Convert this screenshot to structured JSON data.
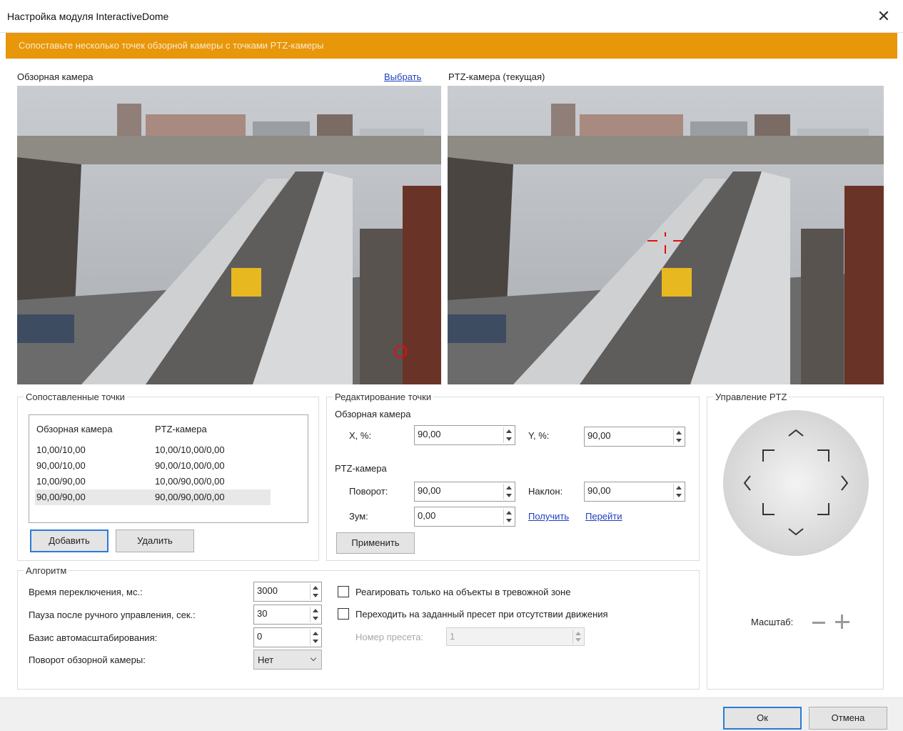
{
  "window": {
    "title": "Настройка модуля InteractiveDome",
    "close_glyph": "✕"
  },
  "banner": {
    "text": "Сопоставьте несколько точек обзорной камеры с точками PTZ-камеры"
  },
  "overview_camera": {
    "label": "Обзорная камера",
    "select_link": "Выбрать"
  },
  "ptz_camera": {
    "label": "PTZ-камера (текущая)"
  },
  "mapped_points": {
    "group_title": "Сопоставленные точки",
    "columns": [
      "Обзорная камера",
      "PTZ-камера"
    ],
    "rows": [
      [
        "10,00/10,00",
        "10,00/10,00/0,00"
      ],
      [
        "90,00/10,00",
        "90,00/10,00/0,00"
      ],
      [
        "10,00/90,00",
        "10,00/90,00/0,00"
      ],
      [
        "90,00/90,00",
        "90,00/90,00/0,00"
      ]
    ],
    "add_button": "Добавить",
    "delete_button": "Удалить"
  },
  "edit_point": {
    "group_title": "Редактирование точки",
    "overview_section": "Обзорная камера",
    "x_label": "X, %:",
    "x_value": "90,00",
    "y_label": "Y, %:",
    "y_value": "90,00",
    "ptz_section": "PTZ-камера",
    "pan_label": "Поворот:",
    "pan_value": "90,00",
    "tilt_label": "Наклон:",
    "tilt_value": "90,00",
    "zoom_label": "Зум:",
    "zoom_value": "0,00",
    "get_link": "Получить",
    "goto_link": "Перейти",
    "apply_button": "Применить"
  },
  "ptz_control": {
    "group_title": "Управление PTZ",
    "zoom_label": "Масштаб:"
  },
  "algorithm": {
    "group_title": "Алгоритм",
    "switch_time_label": "Время переключения, мс.:",
    "switch_time_value": "3000",
    "pause_label": "Пауза после ручного управления, сек.:",
    "pause_value": "30",
    "autoscale_label": "Базис автомасштабирования:",
    "autoscale_value": "0",
    "rotation_label": "Поворот обзорной камеры:",
    "rotation_value": "Нет",
    "alarm_zone_checkbox": "Реагировать только на объекты в тревожной зоне",
    "preset_checkbox": "Переходить на заданный пресет при отсутствии движения",
    "preset_number_label": "Номер пресета:",
    "preset_number_value": "1"
  },
  "footer": {
    "ok_button": "Ок",
    "cancel_button": "Отмена"
  },
  "colors": {
    "banner": "#e8960a",
    "accent_blue": "#2b7bd8",
    "link": "#1f3fbf",
    "marker_red": "#e01010"
  }
}
